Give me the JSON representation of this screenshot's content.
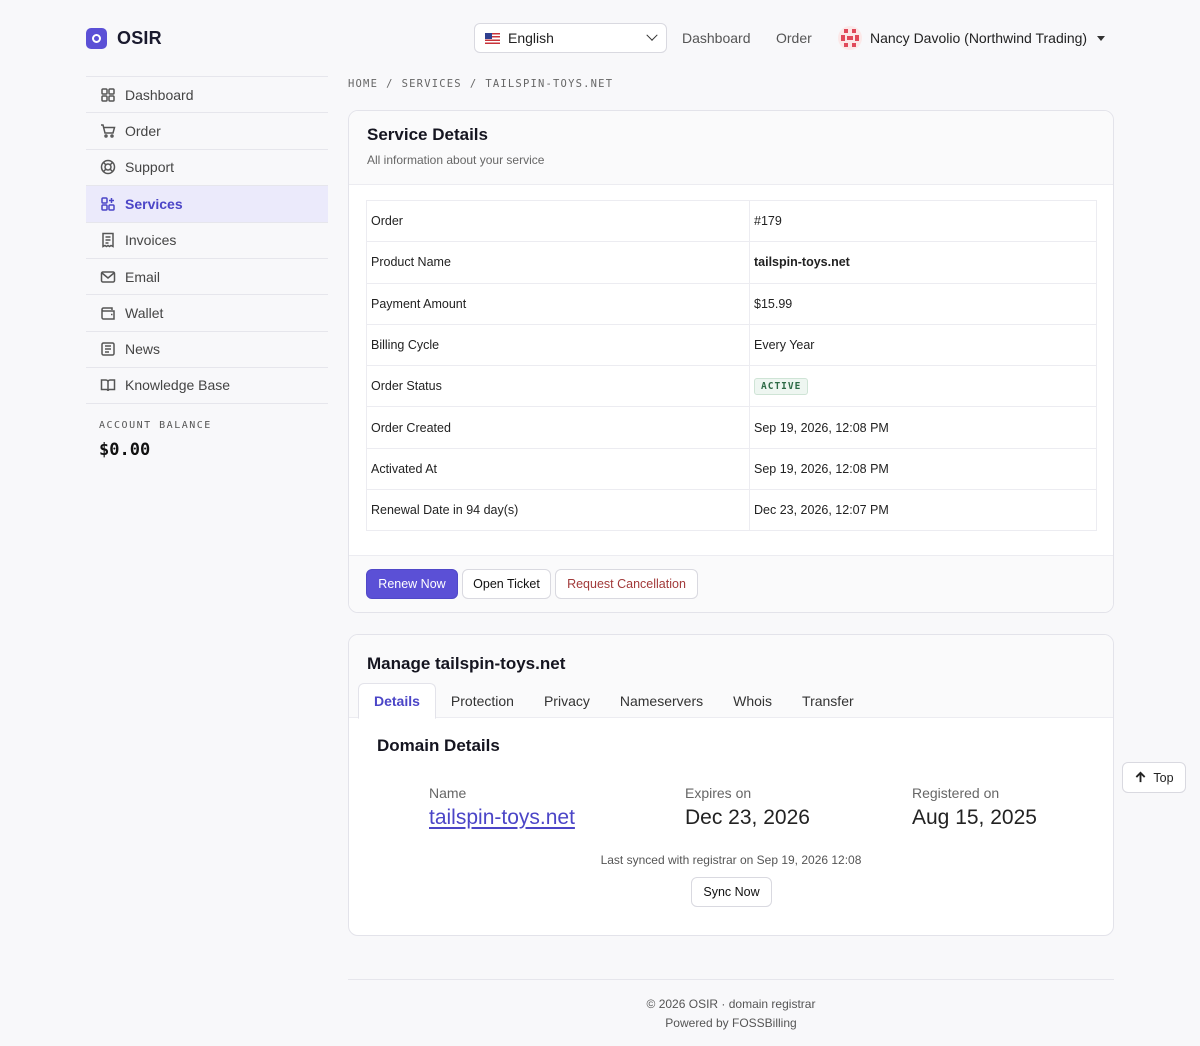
{
  "brand": {
    "name": "OSIR"
  },
  "header": {
    "language": "English",
    "nav": [
      "Dashboard",
      "Order"
    ],
    "user": "Nancy Davolio (Northwind Trading)"
  },
  "sidebar": {
    "items": [
      {
        "label": "Dashboard",
        "icon": "grid-icon"
      },
      {
        "label": "Order",
        "icon": "cart-icon"
      },
      {
        "label": "Support",
        "icon": "lifebuoy-icon"
      },
      {
        "label": "Services",
        "icon": "apps-icon",
        "active": true
      },
      {
        "label": "Invoices",
        "icon": "receipt-icon"
      },
      {
        "label": "Email",
        "icon": "mail-icon"
      },
      {
        "label": "Wallet",
        "icon": "wallet-icon"
      },
      {
        "label": "News",
        "icon": "news-icon"
      },
      {
        "label": "Knowledge Base",
        "icon": "book-icon"
      }
    ],
    "balance_label": "ACCOUNT BALANCE",
    "balance_value": "$0.00"
  },
  "breadcrumb": [
    "HOME",
    "/",
    "SERVICES",
    "/",
    "TAILSPIN-TOYS.NET"
  ],
  "service": {
    "title": "Service Details",
    "subtitle": "All information about your service",
    "rows": [
      {
        "label": "Order",
        "value": "#179"
      },
      {
        "label": "Product Name",
        "value": "tailspin-toys.net"
      },
      {
        "label": "Payment Amount",
        "value": "$15.99"
      },
      {
        "label": "Billing Cycle",
        "value": "Every Year"
      },
      {
        "label": "Order Status",
        "value": "ACTIVE"
      },
      {
        "label": "Order Created",
        "value": "Sep 19, 2026, 12:08 PM"
      },
      {
        "label": "Activated At",
        "value": "Sep 19, 2026, 12:08 PM"
      },
      {
        "label": "Renewal Date in 94 day(s)",
        "value": "Dec 23, 2026, 12:07 PM"
      }
    ],
    "buttons": {
      "renew": "Renew Now",
      "ticket": "Open Ticket",
      "cancel": "Request Cancellation"
    },
    "status_color": "#2d6a46"
  },
  "manage": {
    "title": "Manage tailspin-toys.net",
    "tabs": [
      "Details",
      "Protection",
      "Privacy",
      "Nameservers",
      "Whois",
      "Transfer"
    ],
    "active_tab": "Details",
    "domain_title": "Domain Details",
    "name_label": "Name",
    "name_value": "tailspin-toys.net",
    "expires_label": "Expires on",
    "expires_value": "Dec 23, 2026",
    "registered_label": "Registered on",
    "registered_value": "Aug 15, 2025",
    "sync_note": "Last synced with registrar on Sep 19, 2026 12:08",
    "sync_button": "Sync Now"
  },
  "top_button": "Top",
  "footer": {
    "line1": "© 2026 OSIR · domain registrar",
    "line2": "Powered by FOSSBilling"
  },
  "colors": {
    "accent": "#5b50d6",
    "active_bg": "#ebeafb",
    "danger": "#a23a3a"
  }
}
